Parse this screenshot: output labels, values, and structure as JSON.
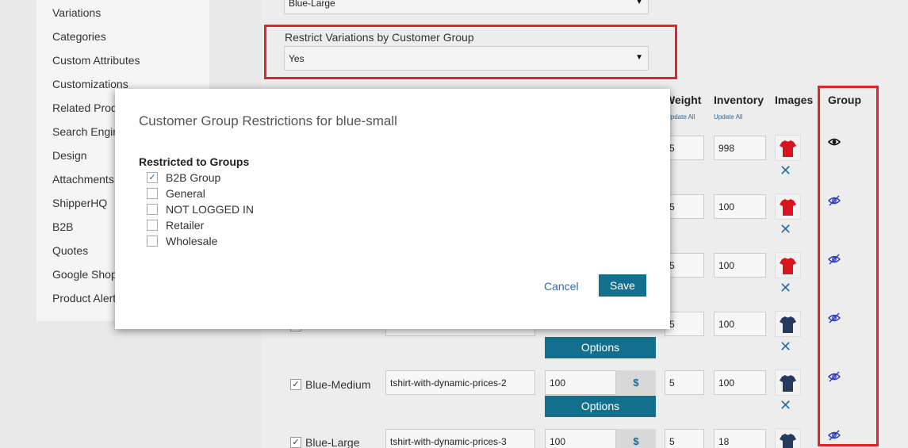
{
  "sidebar": {
    "items": [
      "Variations",
      "Categories",
      "Custom Attributes",
      "Customizations",
      "Related Prod",
      "Search Engin",
      "Design",
      "Attachments",
      "ShipperHQ",
      "B2B",
      "Quotes",
      "Google Shop",
      "Product Alert"
    ]
  },
  "top_select": {
    "value": "Blue-Large"
  },
  "restrict": {
    "label": "Restrict Variations by Customer Group",
    "value": "Yes"
  },
  "table": {
    "headers": {
      "weight": "Weight",
      "inventory": "Inventory",
      "images": "Images",
      "group": "Group"
    },
    "update_all": "Update All",
    "options_label": "Options",
    "currency_symbol": "$",
    "rows": [
      {
        "weight": "5",
        "inventory": "998"
      },
      {
        "weight": "5",
        "inventory": "100"
      },
      {
        "weight": "5",
        "inventory": "100"
      },
      {
        "weight": "5",
        "inventory": "100"
      },
      {
        "name": "Blue-Medium",
        "sku": "tshirt-with-dynamic-prices-2",
        "price": "100",
        "weight": "5",
        "inventory": "100"
      },
      {
        "name": "Blue-Large",
        "sku": "tshirt-with-dynamic-prices-3",
        "price": "100",
        "weight": "5",
        "inventory": "18"
      }
    ]
  },
  "modal": {
    "title": "Customer Group Restrictions for blue-small",
    "section_heading": "Restricted to Groups",
    "groups": [
      {
        "label": "B2B Group",
        "checked": true
      },
      {
        "label": "General",
        "checked": false
      },
      {
        "label": "NOT LOGGED IN",
        "checked": false
      },
      {
        "label": "Retailer",
        "checked": false
      },
      {
        "label": "Wholesale",
        "checked": false
      }
    ],
    "cancel_label": "Cancel",
    "save_label": "Save"
  },
  "colors": {
    "highlight": "#e2232a",
    "primary_button": "#14708f",
    "link": "#2571b5"
  },
  "icons": {
    "dropdown": "▼",
    "check": "✓",
    "remove": "✕"
  }
}
